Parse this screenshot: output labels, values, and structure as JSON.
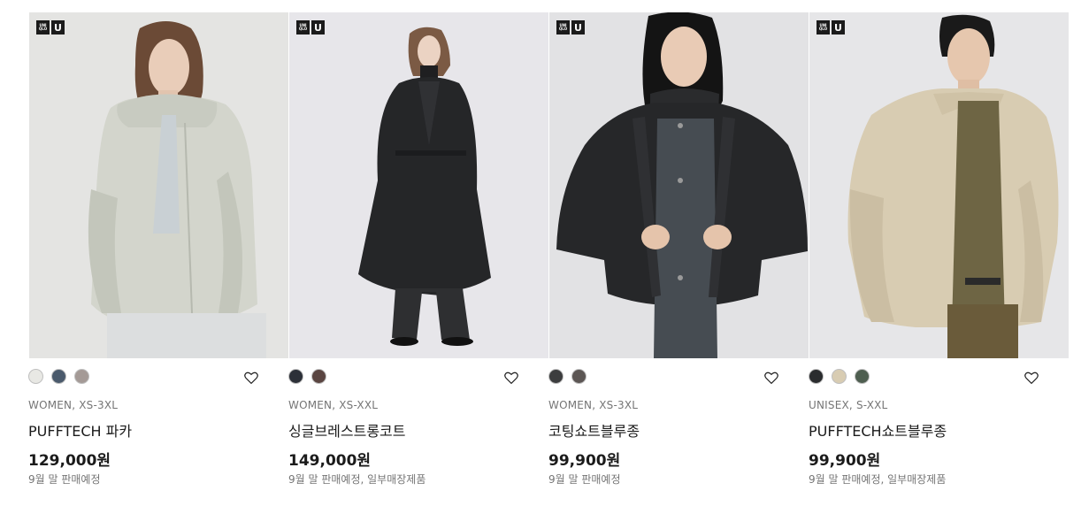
{
  "products": [
    {
      "logo_text": [
        "UNI",
        "QLO"
      ],
      "logo_u": "U",
      "colors": [
        "#e8e8e4",
        "#4a5a6c",
        "#a49a96"
      ],
      "meta": "WOMEN, XS-3XL",
      "name": "PUFFTECH 파카",
      "price": "129,000원",
      "note": "9월 말 판매예정"
    },
    {
      "logo_text": [
        "UNI",
        "QLO"
      ],
      "logo_u": "U",
      "colors": [
        "#2c3038",
        "#5a4541"
      ],
      "meta": "WOMEN, XS-XXL",
      "name": "싱글브레스트롱코트",
      "price": "149,000원",
      "note": "9월 말 판매예정, 일부매장제품"
    },
    {
      "logo_text": [
        "UNI",
        "QLO"
      ],
      "logo_u": "U",
      "colors": [
        "#3c3d3e",
        "#5c5654"
      ],
      "meta": "WOMEN, XS-3XL",
      "name": "코팅쇼트블루종",
      "price": "99,900원",
      "note": "9월 말 판매예정"
    },
    {
      "logo_text": [
        "UNI",
        "QLO"
      ],
      "logo_u": "U",
      "colors": [
        "#2a2c2e",
        "#d8ccb2",
        "#4e5e50"
      ],
      "meta": "UNISEX, S-XXL",
      "name": "PUFFTECH쇼트블루종",
      "price": "99,900원",
      "note": "9월 말 판매예정, 일부매장제품"
    }
  ]
}
